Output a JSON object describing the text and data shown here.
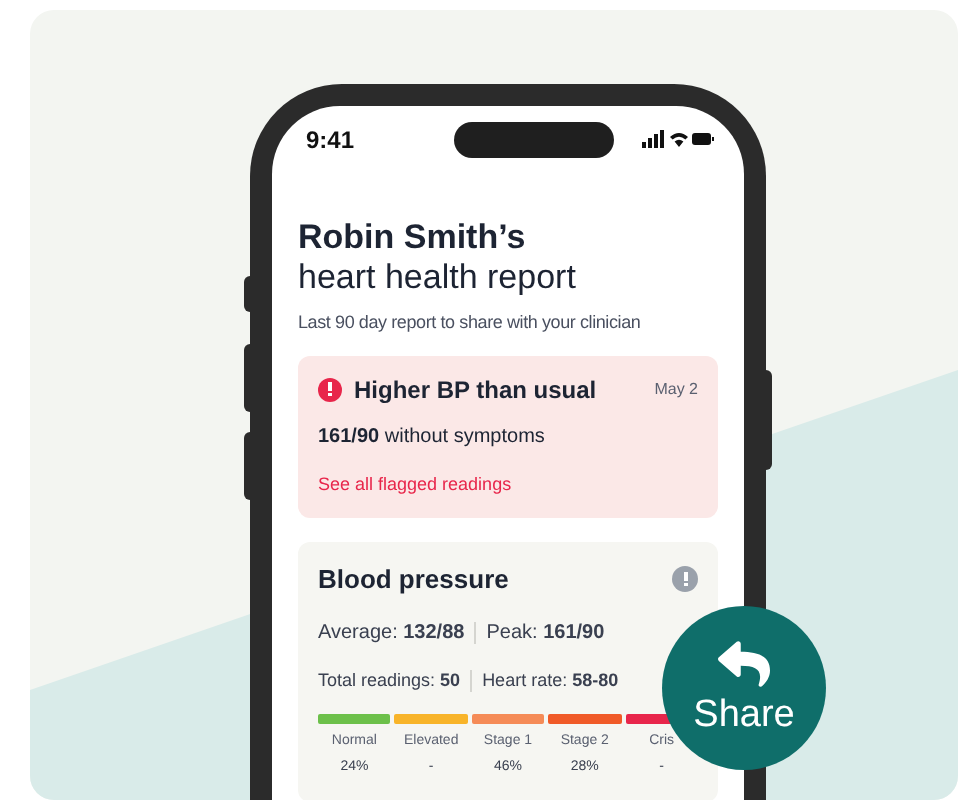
{
  "status_bar": {
    "time": "9:41"
  },
  "header": {
    "name": "Robin Smith’s",
    "title": "heart health report",
    "subtitle": "Last 90 day report to share with your clinician"
  },
  "alert": {
    "title": "Higher BP than usual",
    "date": "May 2",
    "detail": "**161/90** without symptoms",
    "link": "See all flagged readings"
  },
  "blood_pressure": {
    "title": "Blood pressure",
    "stats": [
      [
        "Average: **132/88**",
        "Peak: **161/90**"
      ],
      [
        "Total readings: **50**",
        "Heart rate: **58-80**"
      ]
    ],
    "categories": [
      {
        "label": "Normal",
        "value": "24%",
        "color": "#6cc04a"
      },
      {
        "label": "Elevated",
        "value": "-",
        "color": "#f8b42a"
      },
      {
        "label": "Stage 1",
        "value": "46%",
        "color": "#f58b57"
      },
      {
        "label": "Stage 2",
        "value": "28%",
        "color": "#f05a28"
      },
      {
        "label": "Cris",
        "value": "-",
        "color": "#e8264b"
      }
    ]
  },
  "share_button": {
    "label": "Share"
  }
}
